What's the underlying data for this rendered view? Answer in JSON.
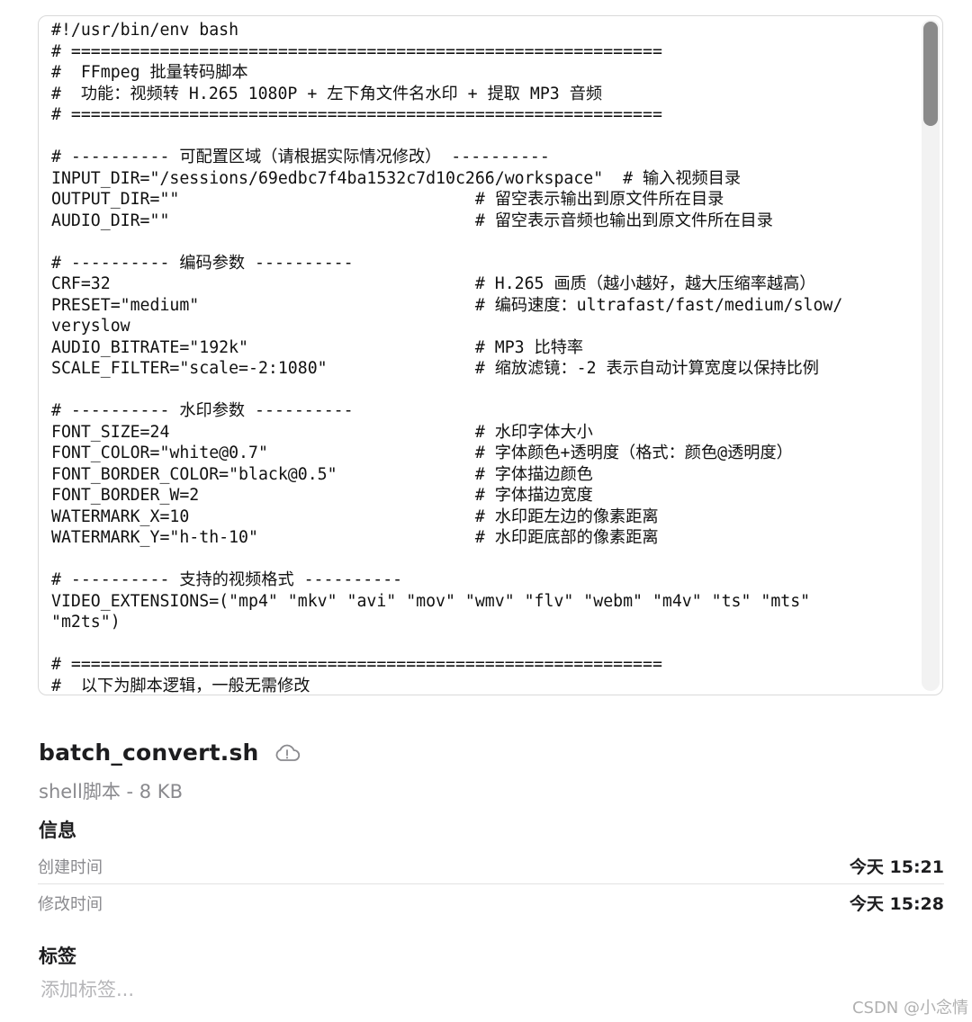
{
  "preview": {
    "code_lines": [
      "#!/usr/bin/env bash",
      "# ============================================================",
      "#  FFmpeg 批量转码脚本",
      "#  功能：视频转 H.265 1080P + 左下角文件名水印 + 提取 MP3 音频",
      "# ============================================================",
      "",
      "# ---------- 可配置区域（请根据实际情况修改） ----------",
      "INPUT_DIR=\"/sessions/69edbc7f4ba1532c7d10c266/workspace\"  # 输入视频目录",
      "OUTPUT_DIR=\"\"                              # 留空表示输出到原文件所在目录",
      "AUDIO_DIR=\"\"                               # 留空表示音频也输出到原文件所在目录",
      "",
      "# ---------- 编码参数 ----------",
      "CRF=32                                     # H.265 画质（越小越好，越大压缩率越高）",
      "PRESET=\"medium\"                            # 编码速度：ultrafast/fast/medium/slow/",
      "veryslow",
      "AUDIO_BITRATE=\"192k\"                       # MP3 比特率",
      "SCALE_FILTER=\"scale=-2:1080\"               # 缩放滤镜：-2 表示自动计算宽度以保持比例",
      "",
      "# ---------- 水印参数 ----------",
      "FONT_SIZE=24                               # 水印字体大小",
      "FONT_COLOR=\"white@0.7\"                     # 字体颜色+透明度（格式：颜色@透明度）",
      "FONT_BORDER_COLOR=\"black@0.5\"              # 字体描边颜色",
      "FONT_BORDER_W=2                            # 字体描边宽度",
      "WATERMARK_X=10                             # 水印距左边的像素距离",
      "WATERMARK_Y=\"h-th-10\"                      # 水印距底部的像素距离",
      "",
      "# ---------- 支持的视频格式 ----------",
      "VIDEO_EXTENSIONS=(\"mp4\" \"mkv\" \"avi\" \"mov\" \"wmv\" \"flv\" \"webm\" \"m4v\" \"ts\" \"mts\"",
      "\"m2ts\")",
      "",
      "# ============================================================",
      "#  以下为脚本逻辑，一般无需修改"
    ]
  },
  "file": {
    "name": "batch_convert.sh",
    "cloud_icon": "cloud-alert-icon",
    "subtitle": "shell脚本 - 8 KB"
  },
  "info": {
    "title": "信息",
    "created_label": "创建时间",
    "created_value": "今天 15:21",
    "modified_label": "修改时间",
    "modified_value": "今天 15:28"
  },
  "tags": {
    "title": "标签",
    "placeholder": "添加标签..."
  },
  "watermark": "CSDN @小念情",
  "colors": {
    "text_primary": "#1d1d1f",
    "text_secondary": "#8a8a8e",
    "placeholder": "#b5b5b8",
    "border": "#d9d9d9",
    "scroll_thumb": "#8a8a8a"
  }
}
